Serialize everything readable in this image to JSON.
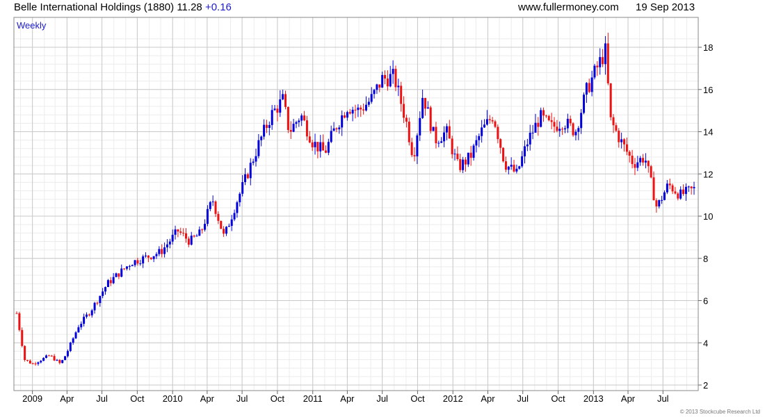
{
  "header": {
    "title": "Belle International Holdings (1880)",
    "price": "11.28",
    "change": "+0.16",
    "site": "www.fullermoney.com",
    "date": "19 Sep 2013"
  },
  "colors": {
    "up": "#0000dd",
    "down": "#ee1111",
    "grid": "#c9c9c9",
    "minor_grid": "#ececec"
  },
  "chart_data": {
    "type": "candlestick",
    "period": "Weekly",
    "y_axis": {
      "min": 2,
      "max": 18,
      "side": "right",
      "tick_labels": [
        "2",
        "4",
        "6",
        "8",
        "10",
        "12",
        "14",
        "16",
        "18"
      ]
    },
    "x_axis": {
      "tick_labels": [
        "2009",
        "Apr",
        "Jul",
        "Oct",
        "2010",
        "Apr",
        "Jul",
        "Oct",
        "2011",
        "Apr",
        "Jul",
        "Oct",
        "2012",
        "Apr",
        "Jul",
        "Oct",
        "2013",
        "Apr",
        "Jul"
      ],
      "dates": [
        "2009-01-01",
        "2009-04-01",
        "2009-07-01",
        "2009-10-01",
        "2010-01-01",
        "2010-04-01",
        "2010-07-01",
        "2010-10-01",
        "2011-01-01",
        "2011-04-01",
        "2011-07-01",
        "2011-10-01",
        "2012-01-01",
        "2012-04-01",
        "2012-07-01",
        "2012-10-01",
        "2013-01-01",
        "2013-04-01",
        "2013-07-01"
      ],
      "start": "2008-11-21",
      "end": "2013-09-20"
    },
    "grid": true,
    "copyright": "© 2013 Stockcube Research Ltd",
    "anchors": [
      [
        "2008-11-21",
        5.4
      ],
      [
        "2008-12-12",
        3.2
      ],
      [
        "2009-01-01",
        3.0
      ],
      [
        "2009-02-15",
        3.4
      ],
      [
        "2009-03-15",
        3.0
      ],
      [
        "2009-03-31",
        3.5
      ],
      [
        "2009-05-01",
        4.8
      ],
      [
        "2009-06-01",
        5.5
      ],
      [
        "2009-07-15",
        6.8
      ],
      [
        "2009-09-15",
        7.8
      ],
      [
        "2009-12-01",
        8.3
      ],
      [
        "2010-01-15",
        9.3
      ],
      [
        "2010-02-15",
        8.8
      ],
      [
        "2010-03-15",
        9.2
      ],
      [
        "2010-04-15",
        10.8
      ],
      [
        "2010-05-15",
        9.0
      ],
      [
        "2010-06-15",
        10.6
      ],
      [
        "2010-07-15",
        12.0
      ],
      [
        "2010-08-15",
        13.5
      ],
      [
        "2010-09-15",
        14.8
      ],
      [
        "2010-10-15",
        15.5
      ],
      [
        "2010-11-01",
        14.0
      ],
      [
        "2010-12-01",
        14.8
      ],
      [
        "2011-01-01",
        13.5
      ],
      [
        "2011-02-01",
        13.0
      ],
      [
        "2011-03-01",
        14.2
      ],
      [
        "2011-04-01",
        15.2
      ],
      [
        "2011-05-01",
        15.0
      ],
      [
        "2011-06-01",
        15.5
      ],
      [
        "2011-07-01",
        16.5
      ],
      [
        "2011-08-01",
        16.6
      ],
      [
        "2011-09-01",
        14.5
      ],
      [
        "2011-09-20",
        12.8
      ],
      [
        "2011-10-15",
        15.8
      ],
      [
        "2011-11-15",
        13.6
      ],
      [
        "2011-12-15",
        14.0
      ],
      [
        "2012-01-15",
        12.3
      ],
      [
        "2012-02-15",
        12.8
      ],
      [
        "2012-03-15",
        14.0
      ],
      [
        "2012-04-15",
        14.8
      ],
      [
        "2012-05-15",
        12.5
      ],
      [
        "2012-06-15",
        12.0
      ],
      [
        "2012-07-15",
        13.6
      ],
      [
        "2012-08-15",
        14.7
      ],
      [
        "2012-09-15",
        14.2
      ],
      [
        "2012-10-15",
        14.5
      ],
      [
        "2012-11-15",
        14.0
      ],
      [
        "2012-12-15",
        16.0
      ],
      [
        "2013-01-15",
        17.2
      ],
      [
        "2013-02-01",
        17.8
      ],
      [
        "2013-02-15",
        14.5
      ],
      [
        "2013-03-15",
        13.5
      ],
      [
        "2013-04-15",
        12.5
      ],
      [
        "2013-05-15",
        12.8
      ],
      [
        "2013-06-15",
        10.4
      ],
      [
        "2013-07-15",
        11.5
      ],
      [
        "2013-08-15",
        11.0
      ],
      [
        "2013-09-20",
        11.28
      ]
    ]
  }
}
